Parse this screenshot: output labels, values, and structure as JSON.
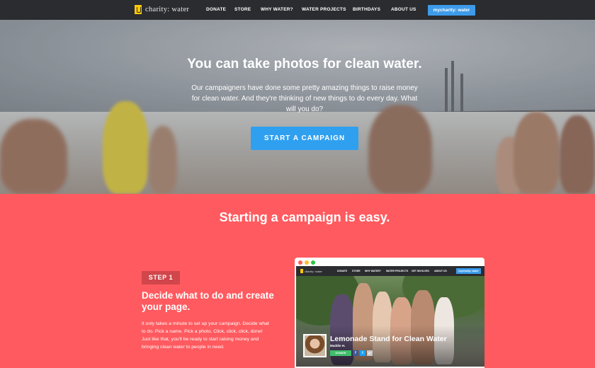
{
  "nav": {
    "logo_text": "charity: water",
    "items": [
      "DONATE",
      "STORE",
      "WHY WATER?",
      "WATER PROJECTS",
      "BIRTHDAYS",
      "ABOUT US"
    ],
    "cta_label": "mycharity: water"
  },
  "hero": {
    "title": "You can take photos for clean water.",
    "body": "Our campaigners have done some pretty amazing things to raise money for clean water. And they're thinking of new things to do every day. What will you do?",
    "button_label": "START A CAMPAIGN"
  },
  "section": {
    "title": "Starting a campaign is easy.",
    "step_label": "STEP 1",
    "step_title": "Decide what to do and create your page.",
    "step_body": "It only takes a minute to set up your campaign. Decide what to do. Pick a name. Pick a photo. Click, click, click, done! Just like that, you'll be ready to start raising money and bringing clean water to people in need."
  },
  "mockup": {
    "logo_text": "charity: water",
    "nav_items": [
      "DONATE",
      "STORE",
      "WHY WATER?",
      "WATER PROJECTS",
      "GET INVOLVED",
      "ABOUT US"
    ],
    "cta_label": "mycharity: water",
    "campaign_title": "Lemonade Stand for Clean Water",
    "campaign_author": "Maddie H.",
    "donate_label": "DONATE",
    "share_icons": [
      "facebook-icon",
      "twitter-icon",
      "google-plus-icon"
    ],
    "share_glyphs": [
      "f",
      "t",
      "g+"
    ]
  },
  "colors": {
    "nav_bg": "#2a2c2f",
    "accent_blue": "#2fa0f0",
    "coral": "#ff5a5f",
    "step_badge": "#d0464b",
    "logo_yellow": "#ffc907",
    "donate_green": "#3fbf6b"
  }
}
